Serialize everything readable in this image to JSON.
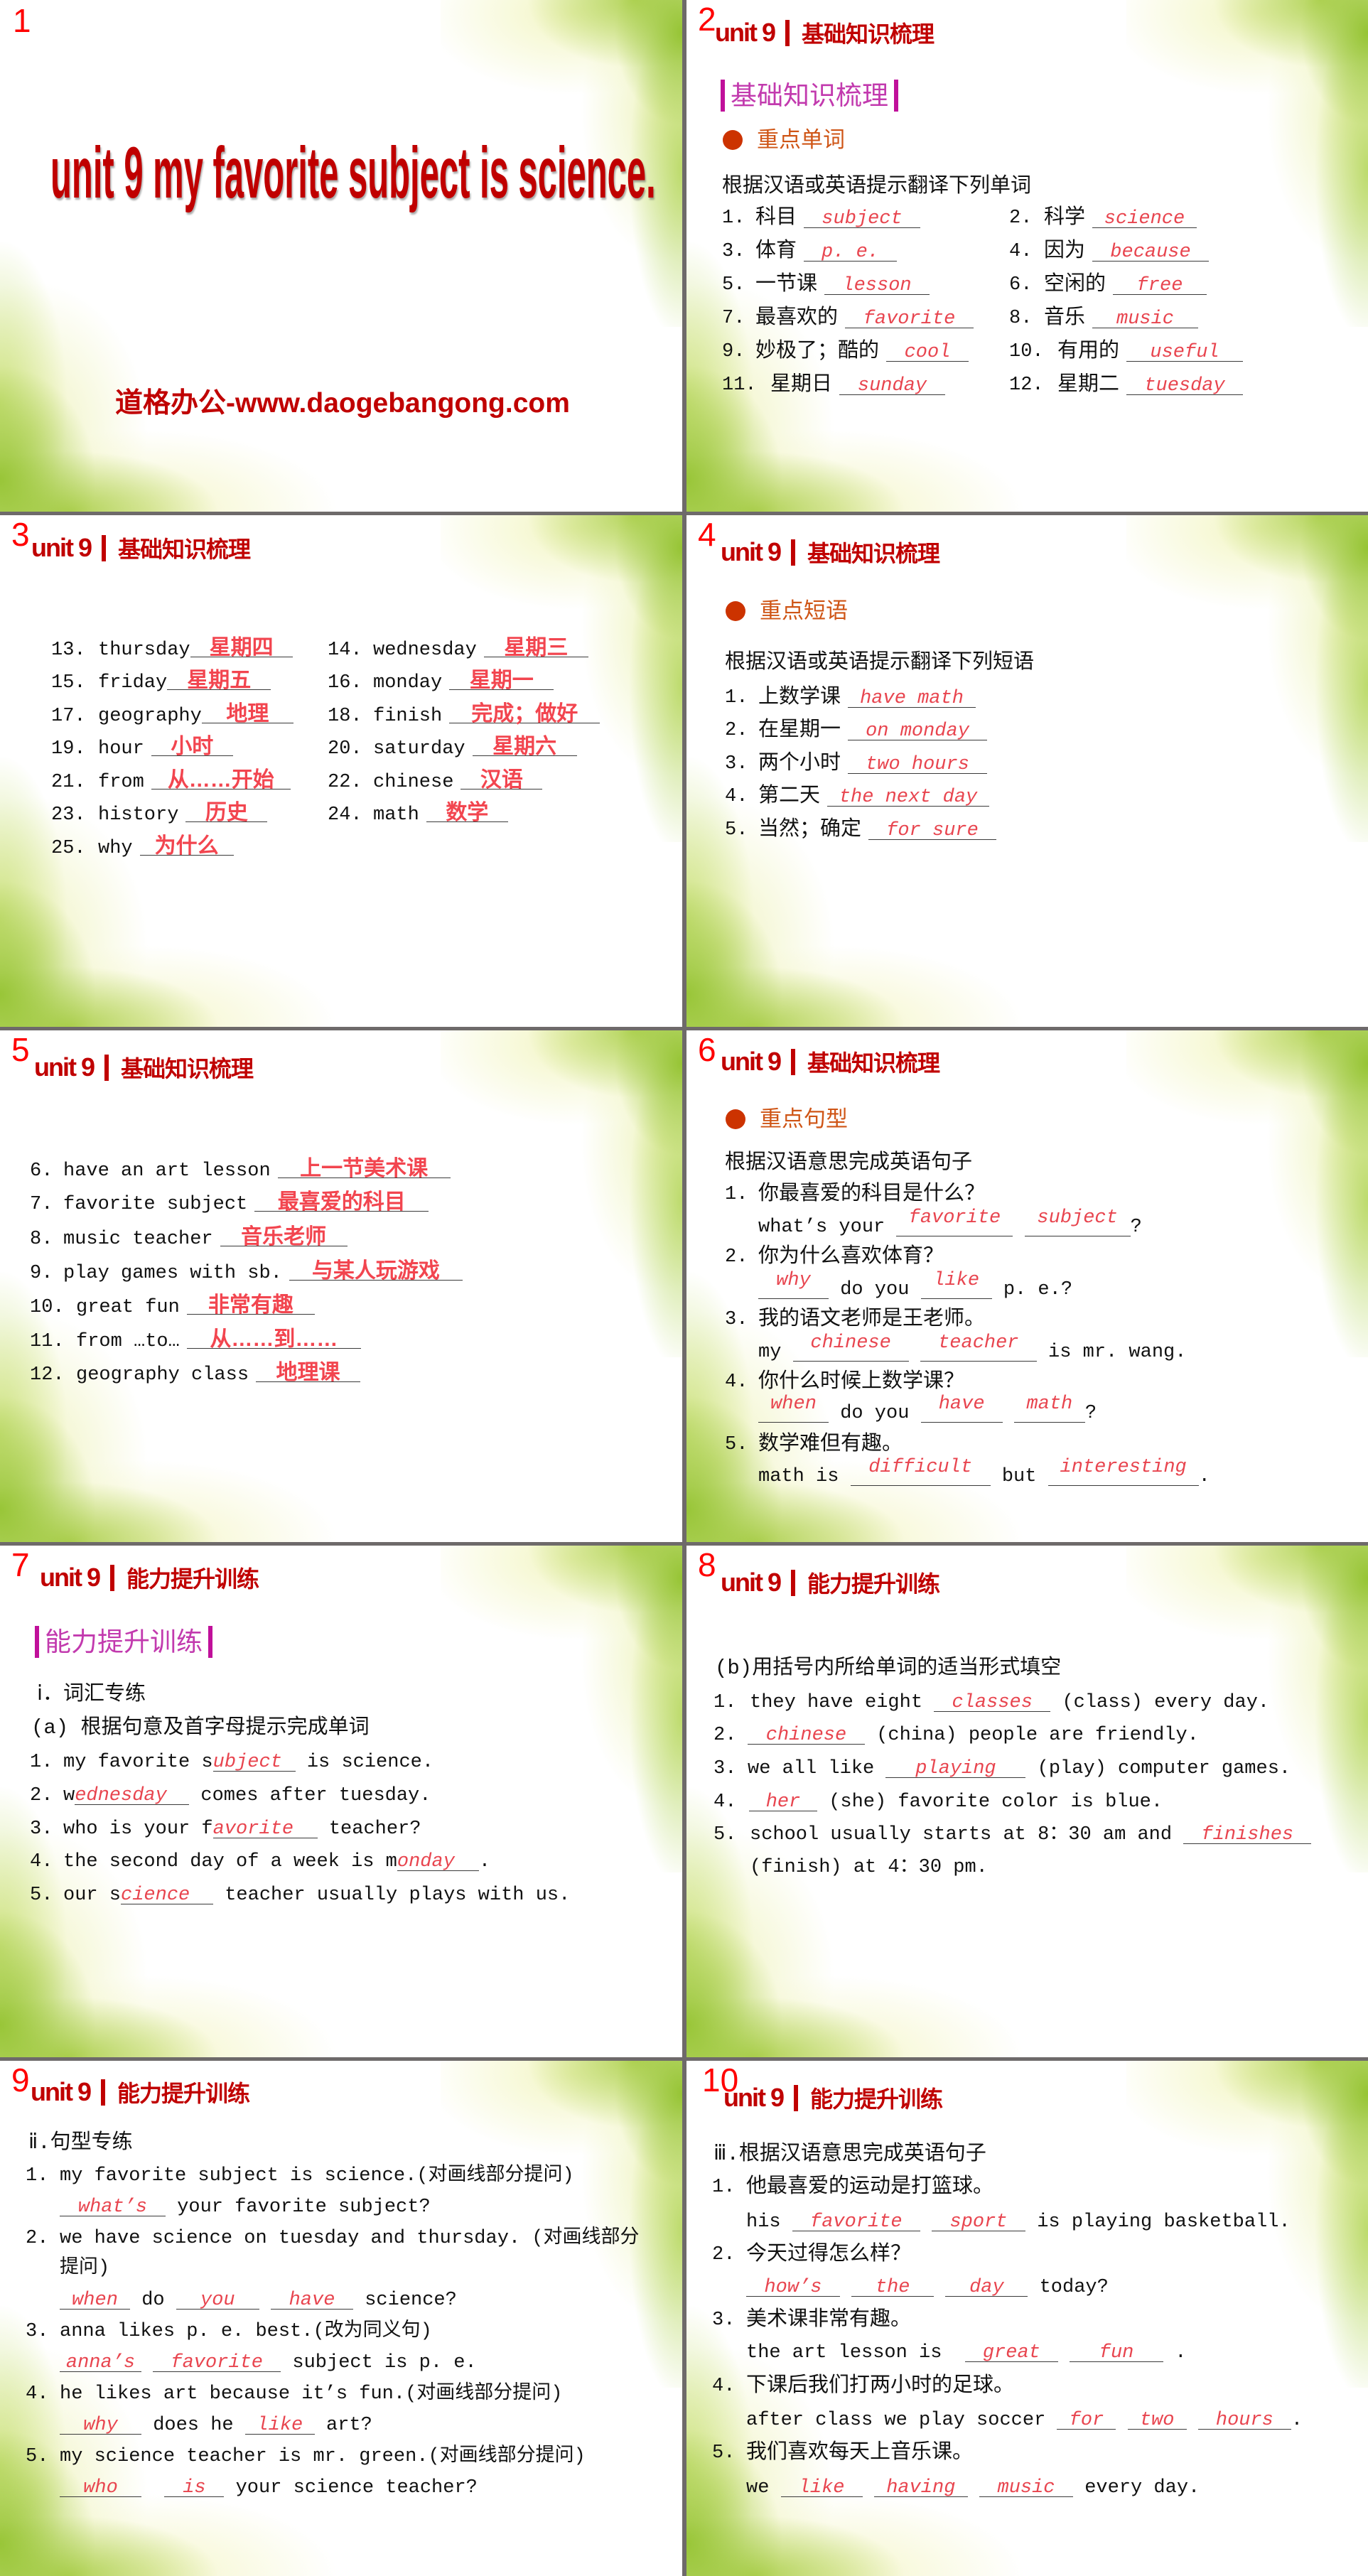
{
  "colors": {
    "slide_number": "#ff0000",
    "header": "#c00000",
    "banner": "#c0109a",
    "bullet": "#cc3300",
    "answer": "#e8454f",
    "divider": "#6e6a6a"
  },
  "slides": [
    {
      "number": "1",
      "title": "unit 9 my favorite subject is science.",
      "website": "道格办公-www.daogebangong.com"
    },
    {
      "number": "2",
      "header": {
        "unit": "unit 9",
        "section": "基础知识梳理"
      },
      "banner": "基础知识梳理",
      "subheading": "重点单词",
      "instruction": "根据汉语或英语提示翻译下列单词",
      "items": [
        {
          "num": "1.",
          "prompt": "科目",
          "answer": "subject"
        },
        {
          "num": "2.",
          "prompt": "科学",
          "answer": "science"
        },
        {
          "num": "3.",
          "prompt": "体育",
          "answer": "p. e."
        },
        {
          "num": "4.",
          "prompt": "因为",
          "answer": "because"
        },
        {
          "num": "5.",
          "prompt": "一节课",
          "answer": "lesson"
        },
        {
          "num": "6.",
          "prompt": "空闲的",
          "answer": "free"
        },
        {
          "num": "7.",
          "prompt": "最喜欢的",
          "answer": "favorite"
        },
        {
          "num": "8.",
          "prompt": "音乐",
          "answer": "music"
        },
        {
          "num": "9.",
          "prompt": "妙极了；酷的",
          "answer": "cool"
        },
        {
          "num": "10.",
          "prompt": "有用的",
          "answer": "useful"
        },
        {
          "num": "11.",
          "prompt": "星期日",
          "answer": "sunday"
        },
        {
          "num": "12.",
          "prompt": "星期二",
          "answer": "tuesday"
        }
      ]
    },
    {
      "number": "3",
      "header": {
        "unit": "unit 9",
        "section": "基础知识梳理"
      },
      "items": [
        {
          "num": "13.",
          "prompt": "thursday",
          "answer": "星期四"
        },
        {
          "num": "14.",
          "prompt": "wednesday",
          "answer": "星期三"
        },
        {
          "num": "15.",
          "prompt": "friday",
          "answer": "星期五"
        },
        {
          "num": "16.",
          "prompt": "monday",
          "answer": "星期一"
        },
        {
          "num": "17.",
          "prompt": "geography",
          "answer": "地理"
        },
        {
          "num": "18.",
          "prompt": "finish",
          "answer": "完成；做好"
        },
        {
          "num": "19.",
          "prompt": "hour",
          "answer": "小时"
        },
        {
          "num": "20.",
          "prompt": "saturday",
          "answer": "星期六"
        },
        {
          "num": "21.",
          "prompt": "from",
          "answer": "从……开始"
        },
        {
          "num": "22.",
          "prompt": "chinese",
          "answer": "汉语"
        },
        {
          "num": "23.",
          "prompt": "history",
          "answer": "历史"
        },
        {
          "num": "24.",
          "prompt": "math",
          "answer": "数学"
        },
        {
          "num": "25.",
          "prompt": "why",
          "answer": "为什么"
        }
      ]
    },
    {
      "number": "4",
      "header": {
        "unit": "unit 9",
        "section": "基础知识梳理"
      },
      "subheading": "重点短语",
      "instruction": "根据汉语或英语提示翻译下列短语",
      "items": [
        {
          "num": "1.",
          "prompt": "上数学课",
          "answer": "have math"
        },
        {
          "num": "2.",
          "prompt": "在星期一",
          "answer": "on monday"
        },
        {
          "num": "3.",
          "prompt": "两个小时",
          "answer": "two hours"
        },
        {
          "num": "4.",
          "prompt": "第二天",
          "answer": "the next day"
        },
        {
          "num": "5.",
          "prompt": "当然；确定",
          "answer": "for sure"
        }
      ]
    },
    {
      "number": "5",
      "header": {
        "unit": "unit 9",
        "section": "基础知识梳理"
      },
      "items": [
        {
          "num": "6.",
          "prompt": "have an art lesson",
          "answer": "上一节美术课"
        },
        {
          "num": "7.",
          "prompt": "favorite subject",
          "answer": "最喜爱的科目"
        },
        {
          "num": "8.",
          "prompt": "music teacher",
          "answer": "音乐老师"
        },
        {
          "num": "9.",
          "prompt": "play games with sb.",
          "answer": "与某人玩游戏"
        },
        {
          "num": "10.",
          "prompt": "great fun",
          "answer": "非常有趣"
        },
        {
          "num": "11.",
          "prompt": "from …to…",
          "answer": "从……到……"
        },
        {
          "num": "12.",
          "prompt": "geography class",
          "answer": "地理课"
        }
      ]
    },
    {
      "number": "6",
      "header": {
        "unit": "unit 9",
        "section": "基础知识梳理"
      },
      "subheading": "重点句型",
      "instruction": "根据汉语意思完成英语句子",
      "items": [
        {
          "num": "1.",
          "chinese": "你最喜爱的科目是什么？",
          "english": {
            "parts": [
              "what’s your ",
              " ",
              "?"
            ],
            "answers": [
              "favorite",
              "subject"
            ]
          }
        },
        {
          "num": "2.",
          "chinese": "你为什么喜欢体育？",
          "english": {
            "parts": [
              "",
              " do you ",
              " p. e.?"
            ],
            "answers": [
              "why",
              "like"
            ]
          }
        },
        {
          "num": "3.",
          "chinese": "我的语文老师是王老师。",
          "english": {
            "parts": [
              "my ",
              " ",
              " is mr. wang."
            ],
            "answers": [
              "chinese",
              "teacher"
            ]
          }
        },
        {
          "num": "4.",
          "chinese": "你什么时候上数学课？",
          "english": {
            "parts": [
              "",
              " do you ",
              " ",
              "?"
            ],
            "answers": [
              "when",
              "have",
              "math"
            ]
          }
        },
        {
          "num": "5.",
          "chinese": "数学难但有趣。",
          "english": {
            "parts": [
              "math is ",
              " but ",
              "."
            ],
            "answers": [
              "difficult",
              "interesting"
            ]
          }
        }
      ]
    },
    {
      "number": "7",
      "header": {
        "unit": "unit 9",
        "section": "能力提升训练"
      },
      "banner": "能力提升训练",
      "part": "ⅰ．词汇专练",
      "instruction": "(a) 根据句意及首字母提示完成单词",
      "items": [
        {
          "num": "1.",
          "parts": [
            "my favorite s",
            " is science."
          ],
          "answers": [
            "ubject"
          ]
        },
        {
          "num": "2.",
          "parts": [
            "w",
            " comes after tuesday."
          ],
          "answers": [
            "ednesday"
          ]
        },
        {
          "num": "3.",
          "parts": [
            "who is your f",
            " teacher?"
          ],
          "answers": [
            "avorite"
          ]
        },
        {
          "num": "4.",
          "parts": [
            "the second day of a week is m",
            "."
          ],
          "answers": [
            "onday"
          ]
        },
        {
          "num": "5.",
          "parts": [
            "our s",
            " teacher usually plays with us."
          ],
          "answers": [
            "cience"
          ]
        }
      ]
    },
    {
      "number": "8",
      "header": {
        "unit": "unit 9",
        "section": "能力提升训练"
      },
      "instruction": "(b)用括号内所给单词的适当形式填空",
      "items": [
        {
          "num": "1.",
          "parts": [
            "they have eight ",
            " (class) every day."
          ],
          "answers": [
            "classes"
          ]
        },
        {
          "num": "2.",
          "parts": [
            "",
            " (china) people are friendly."
          ],
          "answers": [
            "chinese"
          ]
        },
        {
          "num": "3.",
          "parts": [
            "we all like ",
            " (play) computer games."
          ],
          "answers": [
            "playing"
          ]
        },
        {
          "num": "4.",
          "parts": [
            "",
            " (she) favorite color is blue."
          ],
          "answers": [
            "her"
          ]
        },
        {
          "num": "5.",
          "parts": [
            "school usually starts at 8：30 am and ",
            " (finish) at 4：30 pm."
          ],
          "answers": [
            "finishes"
          ]
        }
      ]
    },
    {
      "number": "9",
      "header": {
        "unit": "unit 9",
        "section": "能力提升训练"
      },
      "part": "ⅱ.句型专练",
      "items": [
        {
          "num": "1.",
          "question": "my favorite subject is science.(对画线部分提问)",
          "response": {
            "parts": [
              "",
              " your favorite subject?"
            ],
            "answers": [
              "what’s"
            ]
          }
        },
        {
          "num": "2.",
          "question": "we have science on tuesday and thursday. (对画线部分提问)",
          "response": {
            "parts": [
              "",
              " do ",
              " ",
              " science?"
            ],
            "answers": [
              "when",
              "you",
              "have"
            ]
          }
        },
        {
          "num": "3.",
          "question": "anna likes p. e. best.(改为同义句)",
          "response": {
            "parts": [
              "",
              " ",
              " subject is p. e."
            ],
            "answers": [
              "anna’s",
              "favorite"
            ]
          }
        },
        {
          "num": "4.",
          "question": "he likes art because it’s fun.(对画线部分提问)",
          "response": {
            "parts": [
              "",
              " does he ",
              " art?"
            ],
            "answers": [
              "why",
              "like"
            ]
          }
        },
        {
          "num": "5.",
          "question": "my science teacher is mr. green.(对画线部分提问)",
          "response": {
            "parts": [
              "",
              "  ",
              " your science teacher?"
            ],
            "answers": [
              "who",
              "is"
            ]
          }
        }
      ]
    },
    {
      "number": "10",
      "header": {
        "unit": "unit 9",
        "section": "能力提升训练"
      },
      "part": "ⅲ.根据汉语意思完成英语句子",
      "items": [
        {
          "num": "1.",
          "chinese": "他最喜爱的运动是打篮球。",
          "english": {
            "parts": [
              "his ",
              " ",
              " is playing basketball."
            ],
            "answers": [
              "favorite",
              "sport"
            ]
          }
        },
        {
          "num": "2.",
          "chinese": "今天过得怎么样？",
          "english": {
            "parts": [
              "",
              " ",
              " ",
              " today?"
            ],
            "answers": [
              "how’s",
              "the",
              "day"
            ]
          }
        },
        {
          "num": "3.",
          "chinese": "美术课非常有趣。",
          "english": {
            "parts": [
              "the art lesson is  ",
              " ",
              " ."
            ],
            "answers": [
              "great",
              "fun"
            ]
          }
        },
        {
          "num": "4.",
          "chinese": "下课后我们打两小时的足球。",
          "english": {
            "parts": [
              "after class we play soccer ",
              " ",
              " ",
              "."
            ],
            "answers": [
              "for",
              "two",
              "hours"
            ]
          }
        },
        {
          "num": "5.",
          "chinese": "我们喜欢每天上音乐课。",
          "english": {
            "parts": [
              "we ",
              " ",
              " ",
              " every day."
            ],
            "answers": [
              "like",
              "having",
              "music"
            ]
          }
        }
      ]
    }
  ]
}
